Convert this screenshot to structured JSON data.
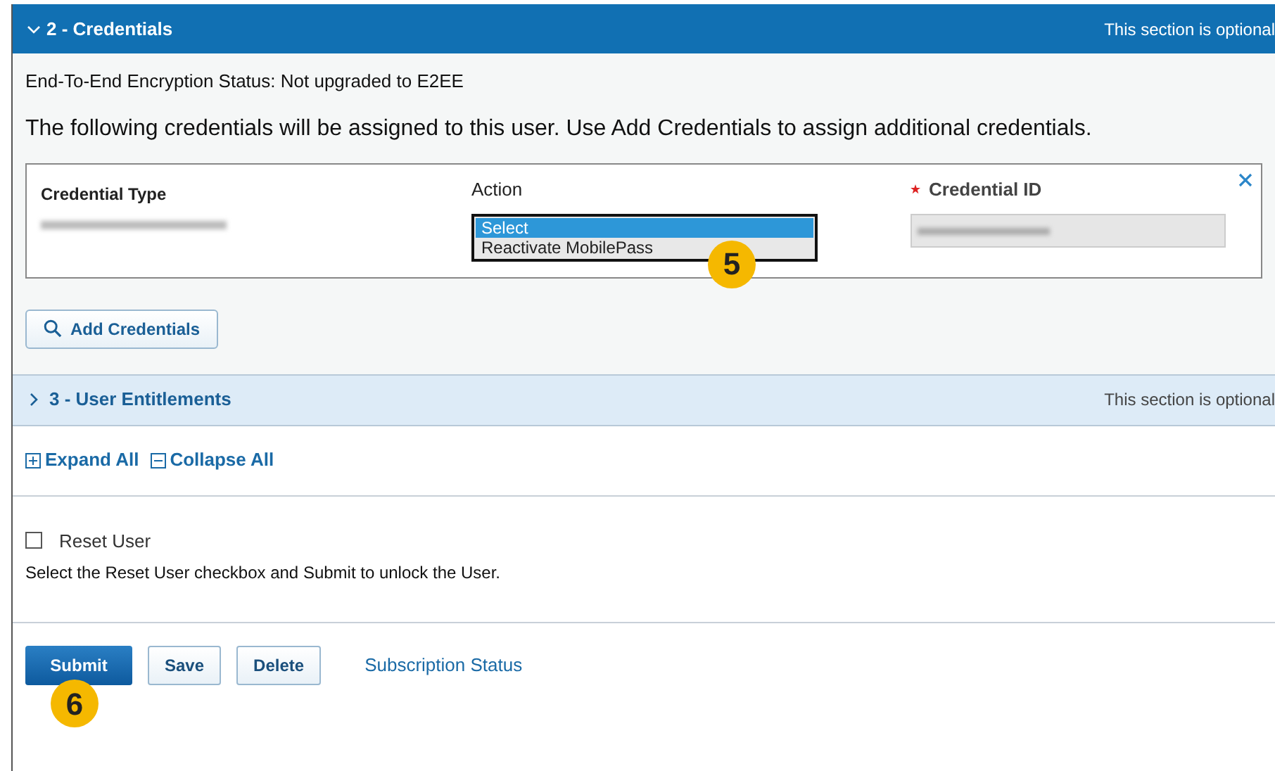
{
  "credentials_section": {
    "title": "2 - Credentials",
    "expanded": true,
    "note": "This section is optional",
    "encryption_status": "End-To-End Encryption Status: Not upgraded to E2EE",
    "intro": "The following credentials will be assigned to this user. Use Add Credentials to assign additional credentials.",
    "table": {
      "columns": [
        "Credential Type",
        "Action",
        "Credential ID"
      ],
      "action_options": [
        {
          "label": "Select",
          "selected": true
        },
        {
          "label": "Reactivate MobilePass",
          "selected": false
        }
      ],
      "action_callout": "5"
    },
    "add_button": "Add Credentials"
  },
  "entitlements_section": {
    "title": "3 - User Entitlements",
    "expanded": false,
    "note": "This section is optional"
  },
  "expand_all": "Expand All",
  "collapse_all": "Collapse All",
  "reset_user": {
    "label": "Reset User",
    "checked": false,
    "help": "Select the Reset User checkbox and Submit to unlock the User."
  },
  "buttons": [
    {
      "label": "Submit",
      "kind": "primary"
    },
    {
      "label": "Save",
      "kind": "secondary"
    },
    {
      "label": "Delete",
      "kind": "secondary"
    },
    {
      "label": "Subscription Status",
      "kind": "link"
    }
  ],
  "submit_callout": "6"
}
